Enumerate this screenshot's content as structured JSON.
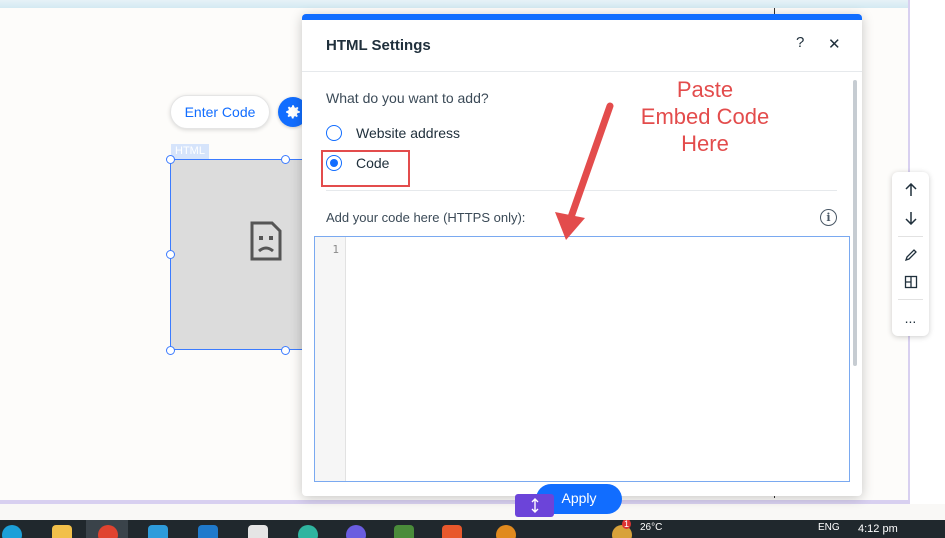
{
  "editor": {
    "enter_code_label": "Enter Code",
    "element_tag": "HTML"
  },
  "dialog": {
    "title": "HTML Settings",
    "help_label": "?",
    "close_label": "✕",
    "question": "What do you want to add?",
    "options": [
      {
        "label": "Website address",
        "selected": false
      },
      {
        "label": "Code",
        "selected": true
      }
    ],
    "code_label": "Add your code here (HTTPS only):",
    "line_number": "1",
    "code_value": "",
    "apply_label": "Apply"
  },
  "annotation": {
    "line1": "Paste",
    "line2": "Embed Code",
    "line3": "Here",
    "color": "#e34c4c"
  },
  "side_toolbar": {
    "icons": [
      "arrow-up-icon",
      "arrow-down-icon",
      "pencil-icon",
      "layout-icon",
      "more-icon"
    ],
    "more_label": "..."
  },
  "taskbar": {
    "weather": "26°C",
    "language": "ENG",
    "time": "4:12 pm",
    "notification_count": "1"
  },
  "colors": {
    "accent": "#116dff",
    "highlight": "#e34c4c",
    "resize_handle": "#6c44d9"
  }
}
